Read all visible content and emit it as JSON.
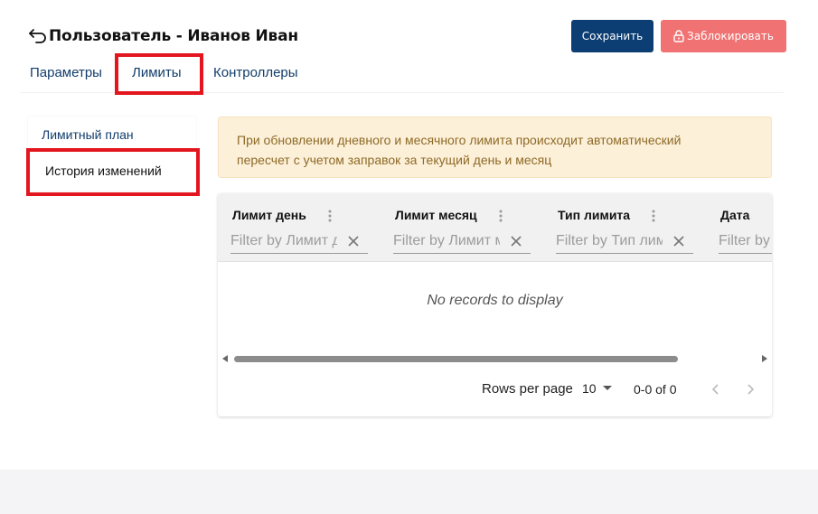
{
  "header": {
    "title": "Пользователь - Иванов Иван",
    "save_label": "Сохранить",
    "block_label": "Заблокировать"
  },
  "tabs": [
    {
      "label": "Параметры"
    },
    {
      "label": "Лимиты"
    },
    {
      "label": "Контроллеры"
    }
  ],
  "sidebar": {
    "items": [
      {
        "label": "Лимитный план"
      },
      {
        "label": "История изменений"
      }
    ]
  },
  "alert": {
    "text_line1": "При обновлении дневного и месячного лимита происходит автоматический",
    "text_line2": "пересчет с учетом заправок за текущий день и месяц"
  },
  "grid": {
    "columns": [
      {
        "title": "Лимит день",
        "filter_placeholder": "Filter by Лимит день"
      },
      {
        "title": "Лимит месяц",
        "filter_placeholder": "Filter by Лимит месяц"
      },
      {
        "title": "Тип лимита",
        "filter_placeholder": "Filter by Тип лимита"
      },
      {
        "title": "Дата",
        "filter_placeholder": "Filter by Дата"
      }
    ],
    "empty_message": "No records to display",
    "pager": {
      "rows_per_page_label": "Rows per page",
      "rows_per_page_value": "10",
      "range": "0-0 of 0"
    }
  },
  "colors": {
    "primary": "#0d3e73",
    "danger": "#f07272",
    "highlight": "#e3161f",
    "alert_bg": "#fdf0d9",
    "alert_text": "#8d6a27"
  }
}
